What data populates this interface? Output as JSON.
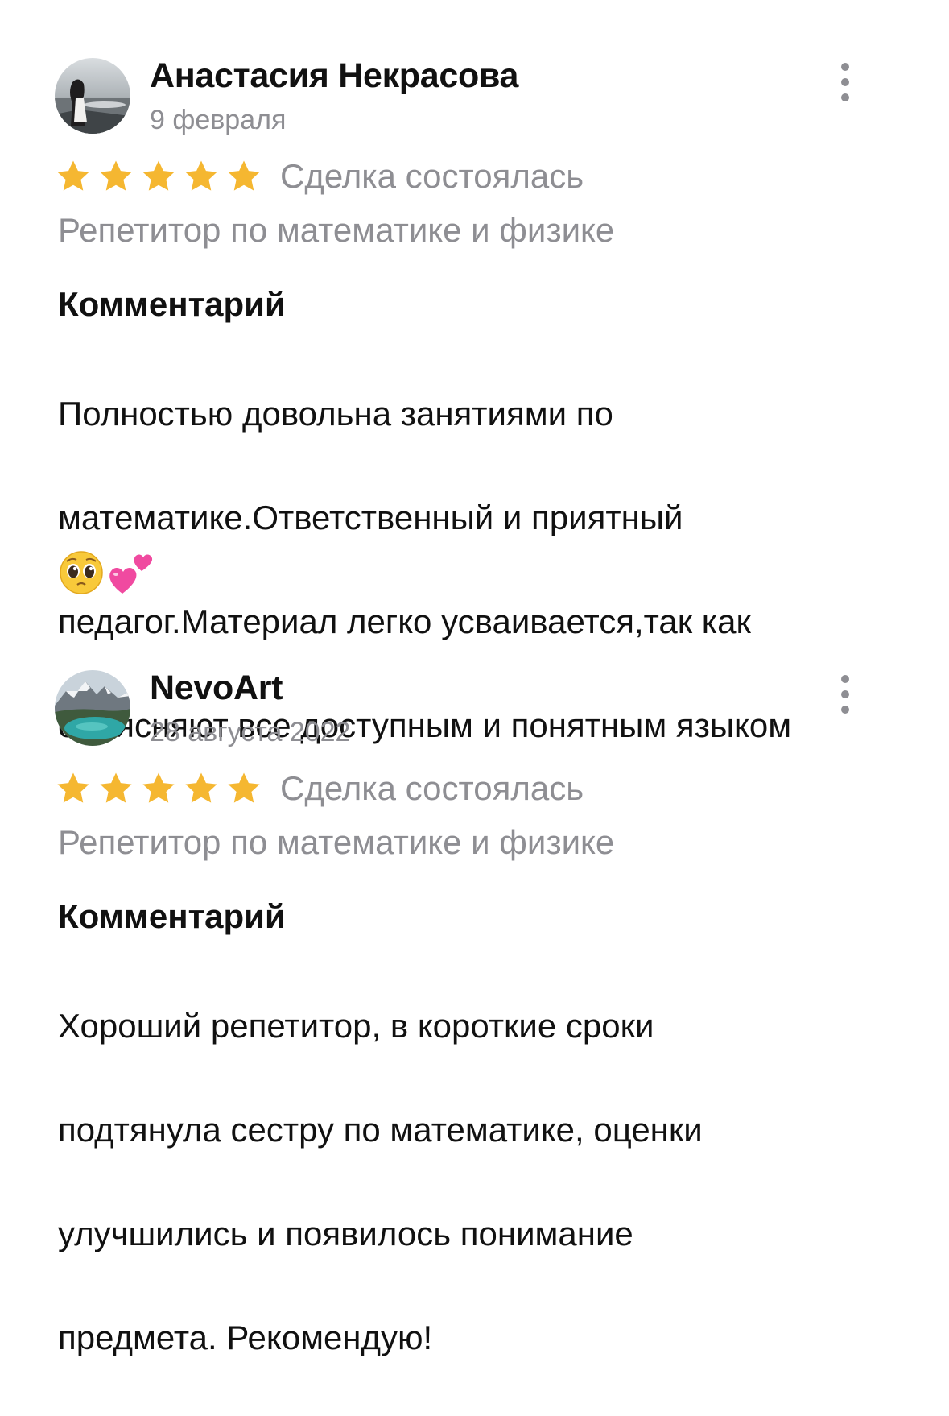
{
  "reviews": [
    {
      "author": "Анастасия Некрасова",
      "date": "9 февраля",
      "rating": 5,
      "rating_max": 5,
      "deal_status": "Сделка состоялась",
      "service": "Репетитор по математике и физике",
      "comment_title": "Комментарий",
      "comment_lines": [
        "Полностью довольна занятиями по",
        "математике.Ответственный и приятный",
        "педагог.Материал легко усваивается,так как",
        "объясняют все доступным и понятным языком"
      ],
      "emojis": [
        "pleading-face-emoji",
        "two-hearts-emoji"
      ]
    },
    {
      "author": "NevoArt",
      "date": "28 августа 2022",
      "rating": 5,
      "rating_max": 5,
      "deal_status": "Сделка состоялась",
      "service": "Репетитор по математике и физике",
      "comment_title": "Комментарий",
      "comment_lines": [
        "Хороший репетитор, в короткие сроки",
        "подтянула сестру по математике, оценки",
        "улучшились и появилось понимание",
        "предмета. Рекомендую!"
      ]
    }
  ],
  "colors": {
    "star": "#f5b731",
    "secondary_text": "#8e8e93",
    "primary_text": "#111111"
  },
  "icons": {
    "menu": "more-vertical-icon",
    "star": "star-icon"
  }
}
